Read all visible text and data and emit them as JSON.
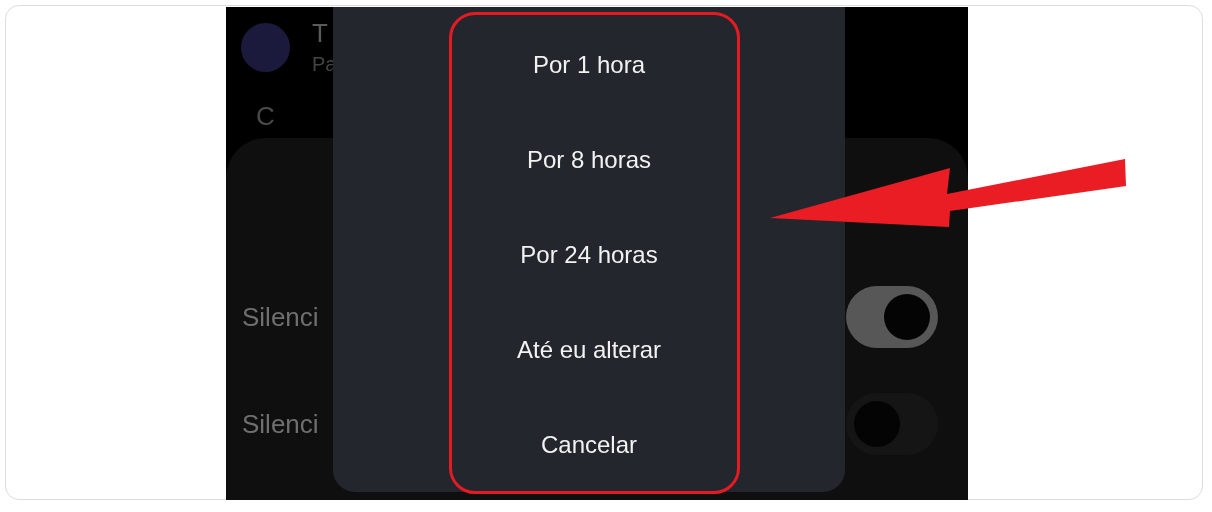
{
  "background": {
    "contact": {
      "name": "T",
      "subtitle": "Pa"
    },
    "section_heading": "C",
    "settings": [
      {
        "label": "Silenci",
        "on": true
      },
      {
        "label": "Silenci",
        "on": false
      }
    ]
  },
  "dialog": {
    "options": [
      "Por 1 hora",
      "Por 8 horas",
      "Por 24 horas",
      "Até eu alterar",
      "Cancelar"
    ]
  }
}
